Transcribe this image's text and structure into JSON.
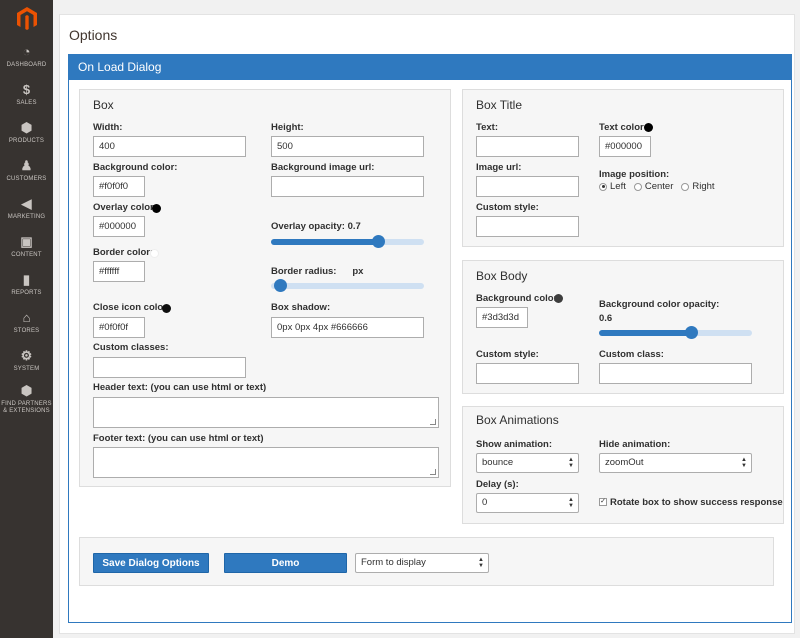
{
  "sidebar": {
    "logo_icon": "magento-logo",
    "items": [
      {
        "label": "DASHBOARD",
        "icon": "dashboard-icon",
        "glyph": "◔"
      },
      {
        "label": "SALES",
        "icon": "dollar-icon",
        "glyph": "$"
      },
      {
        "label": "PRODUCTS",
        "icon": "box-icon",
        "glyph": "⬢"
      },
      {
        "label": "CUSTOMERS",
        "icon": "person-icon",
        "glyph": "♟"
      },
      {
        "label": "MARKETING",
        "icon": "megaphone-icon",
        "glyph": "◀"
      },
      {
        "label": "CONTENT",
        "icon": "layout-icon",
        "glyph": "▣"
      },
      {
        "label": "REPORTS",
        "icon": "bar-chart-icon",
        "glyph": "▮"
      },
      {
        "label": "STORES",
        "icon": "store-icon",
        "glyph": "⌂"
      },
      {
        "label": "SYSTEM",
        "icon": "gear-icon",
        "glyph": "⚙"
      },
      {
        "label": "FIND PARTNERS",
        "label2": "& EXTENSIONS",
        "icon": "extensions-icon",
        "glyph": "⬢"
      }
    ]
  },
  "page": {
    "title": "Options"
  },
  "panel": {
    "title": "On Load Dialog"
  },
  "box": {
    "title": "Box",
    "width_label": "Width:",
    "width_value": "400",
    "height_label": "Height:",
    "height_value": "500",
    "bg_color_label": "Background color:",
    "bg_color_value": "#f0f0f0",
    "bg_image_label": "Background image url:",
    "bg_image_value": "",
    "overlay_color_label": "Overlay color:",
    "overlay_color_value": "#000000",
    "overlay_opacity_label": "Overlay opacity:",
    "overlay_opacity_value": "0.7",
    "overlay_opacity": 0.7,
    "border_color_label": "Border color:",
    "border_color_value": "#ffffff",
    "border_radius_label": "Border radius:",
    "border_radius_unit": "px",
    "border_radius": 0,
    "close_icon_label": "Close icon color:",
    "close_icon_value": "#0f0f0f",
    "box_shadow_label": "Box shadow:",
    "box_shadow_value": "0px 0px 4px #666666",
    "custom_classes_label": "Custom classes:",
    "custom_classes_value": "",
    "header_text_label": "Header text: (you can use html or text)",
    "footer_text_label": "Footer text: (you can use html or text)"
  },
  "box_title": {
    "title": "Box Title",
    "text_label": "Text:",
    "text_value": "",
    "text_color_label": "Text color:",
    "text_color_value": "#000000",
    "image_url_label": "Image url:",
    "image_url_value": "",
    "image_position_label": "Image position:",
    "positions": [
      "Left",
      "Center",
      "Right"
    ],
    "selected_position": "Left",
    "custom_style_label": "Custom style:",
    "custom_style_value": ""
  },
  "box_body": {
    "title": "Box Body",
    "bg_color_label": "Background color:",
    "bg_color_value": "#3d3d3d",
    "bg_opacity_label": "Background color opacity:",
    "bg_opacity_value": "0.6",
    "bg_opacity": 0.6,
    "custom_style_label": "Custom style:",
    "custom_class_label": "Custom class:"
  },
  "box_animations": {
    "title": "Box Animations",
    "show_label": "Show animation:",
    "show_value": "bounce",
    "hide_label": "Hide animation:",
    "hide_value": "zoomOut",
    "delay_label": "Delay (s):",
    "delay_value": "0",
    "rotate_label": "Rotate box to show success response",
    "rotate_checked": true
  },
  "footer": {
    "save_label": "Save Dialog Options",
    "demo_label": "Demo",
    "form_select_value": "Form to display"
  },
  "colors": {
    "accent": "#2f79bf",
    "sidebar": "#373330",
    "logo": "#eb5202"
  }
}
